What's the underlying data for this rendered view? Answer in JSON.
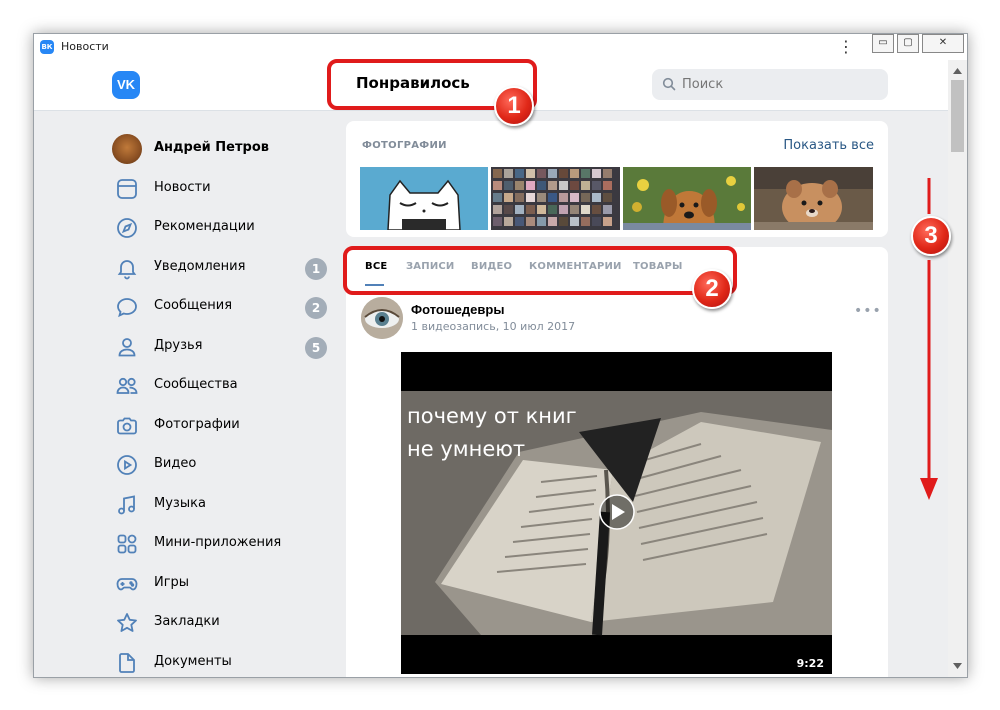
{
  "window": {
    "title": "Новости",
    "app_logo": "ВК",
    "menu_icon": "⋮",
    "minimize_label": "▭",
    "maximize_label": "▢",
    "close_label": "✕"
  },
  "header": {
    "logo": "VK",
    "page_title": "Понравилось",
    "search_placeholder": "Поиск"
  },
  "sidebar": {
    "items": [
      {
        "label": "Андрей Петров",
        "icon": "avatar",
        "badge": ""
      },
      {
        "label": "Новости",
        "icon": "news-icon",
        "badge": ""
      },
      {
        "label": "Рекомендации",
        "icon": "compass-icon",
        "badge": ""
      },
      {
        "label": "Уведомления",
        "icon": "bell-icon",
        "badge": "1"
      },
      {
        "label": "Сообщения",
        "icon": "message-icon",
        "badge": "2"
      },
      {
        "label": "Друзья",
        "icon": "user-icon",
        "badge": "5"
      },
      {
        "label": "Сообщества",
        "icon": "users-icon",
        "badge": ""
      },
      {
        "label": "Фотографии",
        "icon": "camera-icon",
        "badge": ""
      },
      {
        "label": "Видео",
        "icon": "play-icon",
        "badge": ""
      },
      {
        "label": "Музыка",
        "icon": "music-icon",
        "badge": ""
      },
      {
        "label": "Мини-приложения",
        "icon": "apps-icon",
        "badge": ""
      },
      {
        "label": "Игры",
        "icon": "gamepad-icon",
        "badge": ""
      },
      {
        "label": "Закладки",
        "icon": "star-icon",
        "badge": ""
      },
      {
        "label": "Документы",
        "icon": "document-icon",
        "badge": ""
      }
    ]
  },
  "photos": {
    "heading": "ФОТОГРАФИИ",
    "show_all": "Показать все"
  },
  "tabs": [
    "ВСЕ",
    "ЗАПИСИ",
    "ВИДЕО",
    "КОММЕНТАРИИ",
    "ТОВАРЫ"
  ],
  "post": {
    "author": "Фотошедевры",
    "meta": "1 видеозапись, 10 июл 2017",
    "more": "•••",
    "video_line1": "почему от книг",
    "video_line2": "не умнеют",
    "duration": "9:22"
  },
  "annotations": [
    "1",
    "2",
    "3"
  ],
  "colors": {
    "accent": "#2787f5",
    "annotation": "#e01b1b",
    "link": "#2a5885"
  }
}
